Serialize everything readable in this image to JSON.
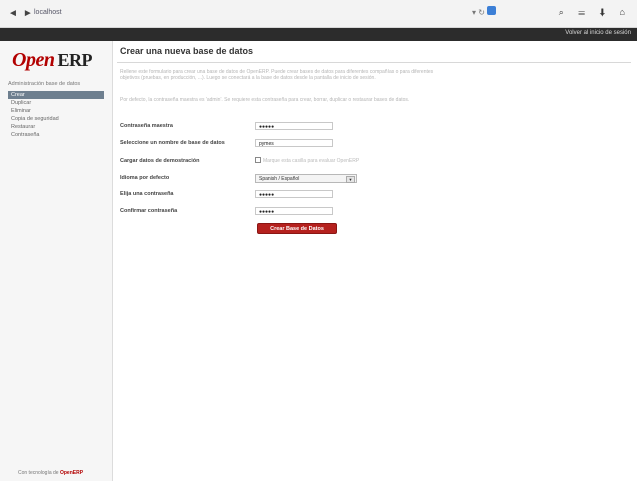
{
  "browser": {
    "url": "localhost",
    "nav_back": "◄",
    "nav_forward": "►",
    "reload": "▾ ↻",
    "tools": "⌕ ☰ ⬇ ⌂"
  },
  "topbar": {
    "back_link": "Volver al inicio de sesión"
  },
  "sidebar": {
    "logo_open": "Open",
    "logo_erp": "ERP",
    "section_title": "Administración base de datos",
    "items": [
      {
        "label": "Crear"
      },
      {
        "label": "Duplicar"
      },
      {
        "label": "Eliminar"
      },
      {
        "label": "Copia de seguridad"
      },
      {
        "label": "Restaurar"
      },
      {
        "label": "Contraseña"
      }
    ],
    "powered_prefix": "Con tecnología de",
    "powered_brand": "OpenERP"
  },
  "main": {
    "title": "Crear una nueva base de datos",
    "description_1": "Rellene este formulario para crear una base de datos de OpenERP. Puede crear bases de datos para diferentes compañías o para diferentes objetivos (pruebas, en producción, ...). Luego se conectará a la base de datos desde la pantalla de inicio de sesión.",
    "description_2": "Por defecto, la contraseña maestra es 'admin'. Se requiere esta contraseña para crear, borrar, duplicar o restaurar bases de datos.",
    "fields": {
      "master_password_label": "Contraseña maestra",
      "master_password_value": "●●●●●",
      "db_name_label": "Seleccione un nombre de base de datos",
      "db_name_value": "pymes",
      "demo_data_label": "Cargar datos de demostración",
      "demo_data_hint": "Marque esta casilla para evaluar OpenERP",
      "language_label": "Idioma por defecto",
      "language_value": "Spanish / Español",
      "admin_password_label": "Elija una contraseña",
      "admin_password_value": "●●●●●",
      "confirm_password_label": "Confirmar contraseña",
      "confirm_password_value": "●●●●●"
    },
    "create_button": "Crear Base de Datos"
  }
}
